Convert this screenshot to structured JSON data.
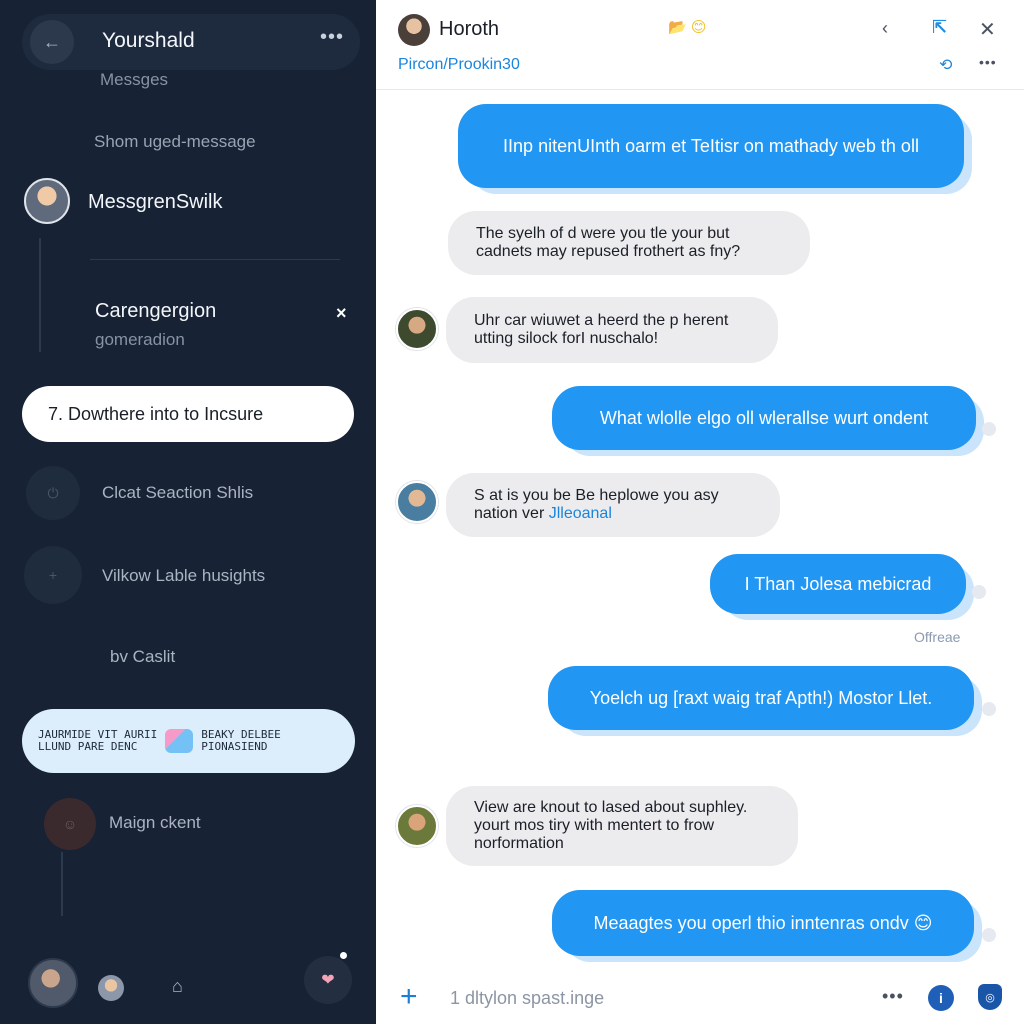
{
  "colors": {
    "sidebar_bg": "#172234",
    "accent_blue": "#2196f3",
    "incoming_bubble": "#ececee",
    "link_blue": "#1b85dc"
  },
  "sidebar": {
    "back_icon": "back-arrow-icon",
    "title": "Yourshald",
    "more_icon": "more-horizontal-icon",
    "subtitle": "Messges",
    "show_text": "Shom uged-message",
    "contact": {
      "name": "MessgrenSwilk"
    },
    "group": {
      "name": "Carengergion",
      "subtitle": "gomeradion",
      "close_label": "×"
    },
    "highlight_pill": "7. Dowthere into to Incsure",
    "items": [
      {
        "icon": "power-icon",
        "label": "Clcat Seaction Shlis"
      },
      {
        "icon": "circle-icon",
        "label": "Vilkow Lable husights"
      },
      {
        "label": "bv Caslit"
      },
      {
        "icon": "smile-icon",
        "label": "Maign ckent"
      }
    ],
    "promo_pill": {
      "left_lines": [
        "JAURMIDE VIT AURII",
        "LLUND PARE DENC"
      ],
      "right_lines": [
        "BEAKY DELBEE",
        "PIONASIEND"
      ]
    },
    "bottom": {
      "home_icon": "home-icon",
      "heart_icon": "heart-icon"
    }
  },
  "chat": {
    "header": {
      "title": "Horoth",
      "subtitle": "Pircon/Prookin30",
      "emoji": "📂 😊",
      "icons": [
        "chevron-left-icon",
        "collapse-icon",
        "close-icon",
        "refresh-icon",
        "more-horizontal-icon"
      ]
    },
    "messages": [
      {
        "dir": "out",
        "text": "IInp nitenUInth oarm et TeItisr on mathady web th oll"
      },
      {
        "dir": "in",
        "lines": [
          "The syelh of d were you tle your but",
          "cadnets may repused frothert as fny?"
        ]
      },
      {
        "dir": "in",
        "lines": [
          "Uhr car wiuwet a heerd the p herent",
          "utting silock forI nuschalo!"
        ]
      },
      {
        "dir": "out",
        "text": "What wlolle elgo oll wlerallse wurt ondent"
      },
      {
        "dir": "in",
        "lines": [
          "S at is you be Be heplowe you asy",
          "nation ver"
        ],
        "link": "Jlleoanal"
      },
      {
        "dir": "out",
        "text": "I Than Jolesa mebicrad"
      },
      {
        "dir": "out",
        "text": "Yoelch ug [raxt waig traf Apth!) Mostor Llet."
      },
      {
        "dir": "in",
        "lines": [
          "View are knout to lased about suphley.",
          "yourt mos tiry with mentert to frow",
          "norformation"
        ]
      },
      {
        "dir": "out",
        "text": "Meaagtes you operl thio inntenras ondv 😊"
      }
    ],
    "status": "Offreae",
    "composer": {
      "placeholder": "1 dltylon spast.inge",
      "plus_icon": "plus-icon",
      "more_icon": "more-horizontal-icon",
      "info_icon": "info-icon",
      "shield_icon": "shield-icon"
    }
  }
}
